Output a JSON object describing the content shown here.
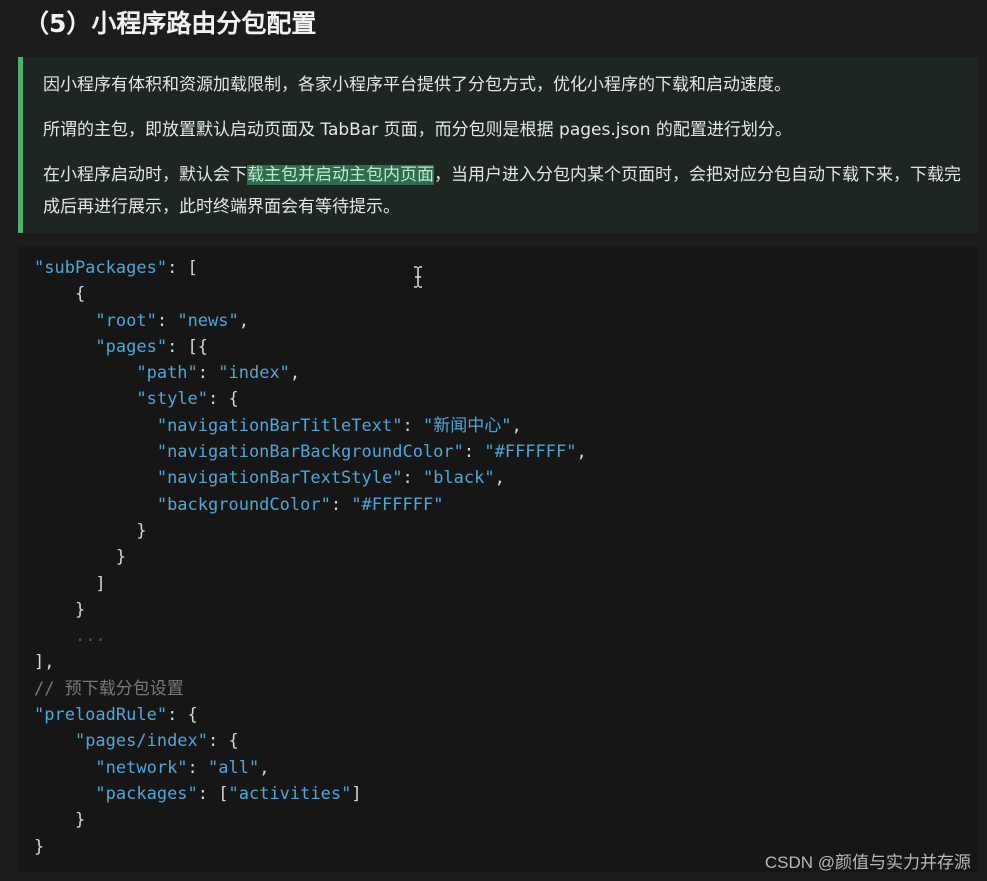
{
  "heading": "（5）小程序路由分包配置",
  "blockquote": {
    "p1": "因小程序有体积和资源加载限制，各家小程序平台提供了分包方式，优化小程序的下载和启动速度。",
    "p2": "所谓的主包，即放置默认启动页面及 TabBar 页面，而分包则是根据 pages.json 的配置进行划分。",
    "p3_before": "在小程序启动时，默认会下",
    "p3_highlight": "载主包并启动主包内页面",
    "p3_after": "，当用户进入分包内某个页面时，会把对应分包自动下载下来，下载完成后再进行展示，此时终端界面会有等待提示。"
  },
  "code": {
    "l01_key": "\"subPackages\"",
    "l01_punct": ": [",
    "l02": "    {",
    "l03_key": "\"root\"",
    "l03_mid": ": ",
    "l03_val": "\"news\"",
    "l03_end": ",",
    "l04_key": "\"pages\"",
    "l04_end": ": [{",
    "l05_key": "\"path\"",
    "l05_mid": ": ",
    "l05_val": "\"index\"",
    "l05_end": ",",
    "l06_key": "\"style\"",
    "l06_end": ": {",
    "l07_key": "\"navigationBarTitleText\"",
    "l07_mid": ": ",
    "l07_val": "\"新闻中心\"",
    "l07_end": ",",
    "l08_key": "\"navigationBarBackgroundColor\"",
    "l08_mid": ": ",
    "l08_val": "\"#FFFFFF\"",
    "l08_end": ",",
    "l09_key": "\"navigationBarTextStyle\"",
    "l09_mid": ": ",
    "l09_val": "\"black\"",
    "l09_end": ",",
    "l10_key": "\"backgroundColor\"",
    "l10_mid": ": ",
    "l10_val": "\"#FFFFFF\"",
    "l11": "}",
    "l12": "}",
    "l13": "]",
    "l14": "}",
    "l15": "...",
    "l16": "],",
    "l17": "// 预下载分包设置",
    "l18_key": "\"preloadRule\"",
    "l18_end": ": {",
    "l19_key": "\"pages/index\"",
    "l19_end": ": {",
    "l20_key": "\"network\"",
    "l20_mid": ": ",
    "l20_val": "\"all\"",
    "l20_end": ",",
    "l21_key": "\"packages\"",
    "l21_mid": ": [",
    "l21_val": "\"activities\"",
    "l21_end": "]",
    "l22": "}",
    "l23": "}"
  },
  "watermark": "CSDN @颜值与实力并存源",
  "colors": {
    "background": "#1c1c1c",
    "quote_bg": "#1e2621",
    "quote_border": "#4caf6a",
    "highlight": "#2f6b4f",
    "code_token": "#4da8d8"
  },
  "icons": {
    "cursor": "text-cursor-icon"
  }
}
